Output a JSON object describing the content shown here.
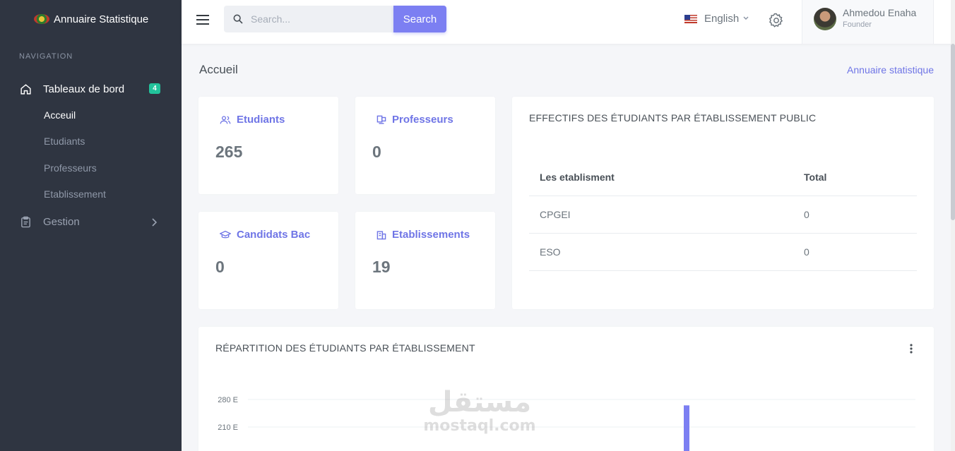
{
  "sidebar": {
    "brand": "Annuaire Statistique",
    "nav_title": "NAVIGATION",
    "dashboard": {
      "label": "Tableaux de bord",
      "badge": "4"
    },
    "sub_items": [
      "Acceuil",
      "Etudiants",
      "Professeurs",
      "Etablissement"
    ],
    "gestion": {
      "label": "Gestion"
    }
  },
  "topbar": {
    "search_placeholder": "Search...",
    "search_button": "Search",
    "language": "English",
    "user_name": "Ahmedou Enaha",
    "user_role": "Founder"
  },
  "page": {
    "title": "Accueil",
    "breadcrumb": "Annuaire statistique"
  },
  "stats": [
    {
      "label": "Etudiants",
      "value": "265",
      "icon": "users-icon"
    },
    {
      "label": "Professeurs",
      "value": "0",
      "icon": "chalkboard-icon"
    },
    {
      "label": "Candidats Bac",
      "value": "0",
      "icon": "graduation-cap-icon"
    },
    {
      "label": "Etablissements",
      "value": "19",
      "icon": "building-icon"
    }
  ],
  "effectifs": {
    "title": "EFFECTIFS DES ÉTUDIANTS PAR ÉTABLISSEMENT PUBLIC",
    "columns": [
      "Les etablisment",
      "Total"
    ],
    "rows": [
      [
        "CPGEI",
        "0"
      ],
      [
        "ESO",
        "0"
      ]
    ]
  },
  "repartition": {
    "title": "RÉPARTITION DES ÉTUDIANTS PAR ÉTABLISSEMENT"
  },
  "chart_data": {
    "type": "bar",
    "title": "RÉPARTITION DES ÉTUDIANTS PAR ÉTABLISSEMENT",
    "tick_labels": [
      "280 E",
      "210 E"
    ],
    "ticks": [
      280,
      210
    ],
    "series": [
      {
        "values": [
          265
        ]
      }
    ],
    "color": "#7c7ff2"
  },
  "watermark": {
    "arabic": "مستقل",
    "latin": "mostaql.com"
  },
  "colors": {
    "accent": "#6f75e6",
    "sidebar": "#2f3541",
    "badge": "#22c39b"
  }
}
